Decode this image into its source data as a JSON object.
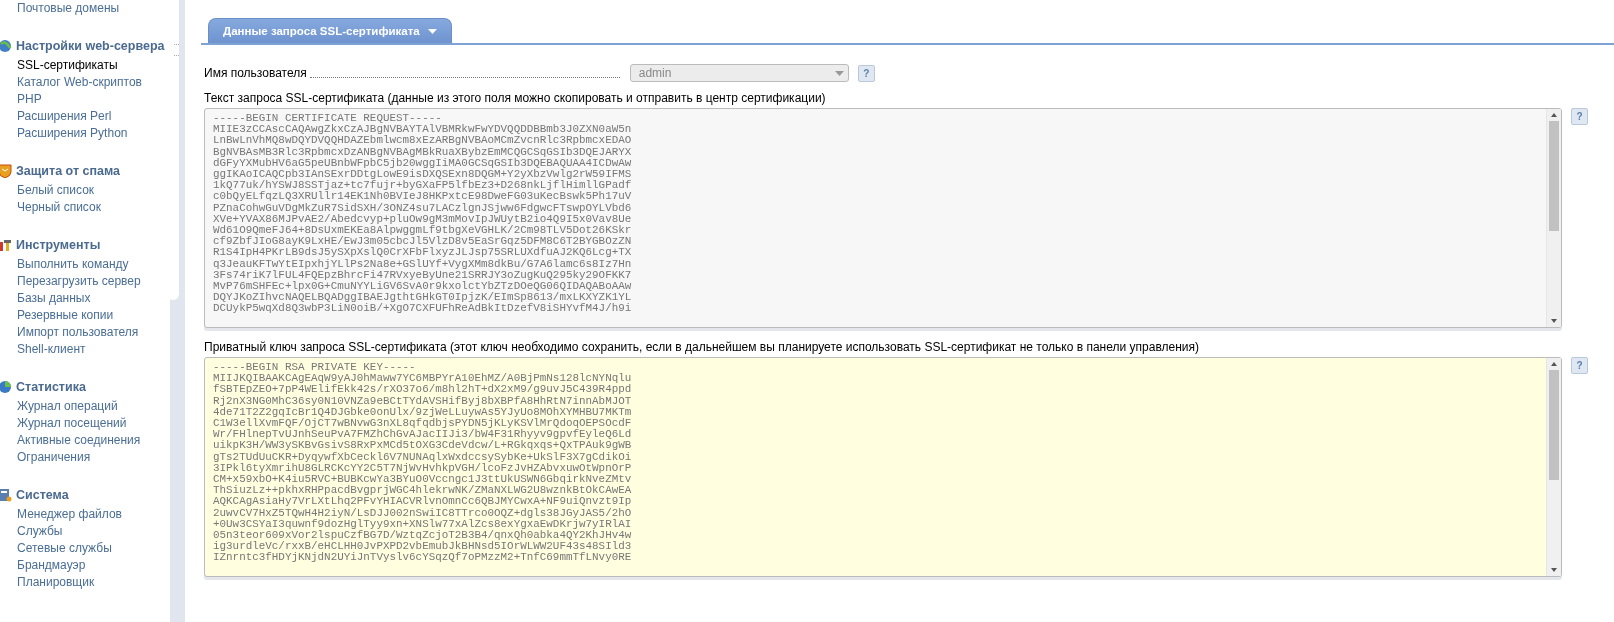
{
  "sidebar": {
    "groups": [
      {
        "items": [
          {
            "label": "Почтовые домены",
            "selected": false
          }
        ]
      },
      {
        "title": "Настройки web-сервера",
        "items": [
          {
            "label": "SSL-сертификаты",
            "selected": true
          },
          {
            "label": "Каталог Web-скриптов",
            "selected": false
          },
          {
            "label": "PHP",
            "selected": false
          },
          {
            "label": "Расширения Perl",
            "selected": false
          },
          {
            "label": "Расширения Python",
            "selected": false
          }
        ]
      },
      {
        "title": "Защита от спама",
        "items": [
          {
            "label": "Белый список",
            "selected": false
          },
          {
            "label": "Черный список",
            "selected": false
          }
        ]
      },
      {
        "title": "Инструменты",
        "items": [
          {
            "label": "Выполнить команду",
            "selected": false
          },
          {
            "label": "Перезагрузить сервер",
            "selected": false
          },
          {
            "label": "Базы данных",
            "selected": false
          },
          {
            "label": "Резервные копии",
            "selected": false
          },
          {
            "label": "Импорт пользователя",
            "selected": false
          },
          {
            "label": "Shell-клиент",
            "selected": false
          }
        ]
      },
      {
        "title": "Статистика",
        "items": [
          {
            "label": "Журнал операций",
            "selected": false
          },
          {
            "label": "Журнал посещений",
            "selected": false
          },
          {
            "label": "Активные соединения",
            "selected": false
          },
          {
            "label": "Ограничения",
            "selected": false
          }
        ]
      },
      {
        "title": "Система",
        "items": [
          {
            "label": "Менеджер файлов",
            "selected": false
          },
          {
            "label": "Службы",
            "selected": false
          },
          {
            "label": "Сетевые службы",
            "selected": false
          },
          {
            "label": "Брандмауэр",
            "selected": false
          },
          {
            "label": "Планировщик",
            "selected": false
          }
        ]
      }
    ]
  },
  "tab": {
    "label": "Данные запроса SSL-сертификата"
  },
  "fields": [
    {
      "kind": "select",
      "label": "Имя пользователя",
      "value": "admin",
      "disabled": true,
      "help": "?"
    },
    {
      "kind": "textarea",
      "label": "Текст запроса SSL-сертификата (данные из этого поля можно скопировать и отправить в центр сертификации)",
      "highlighted": false,
      "help": "?",
      "lines": [
        "-----BEGIN CERTIFICATE REQUEST-----",
        "MIIE3zCCAscCAQAwgZkxCzAJBgNVBAYTAlVBMRkwFwYDVQQDDBBmb3J0ZXN0aW5n",
        "LnBwLnVhMQ8wDQYDVQQHDAZEbmlwcm8xEzARBgNVBAoMCmZvcnRlc3RpbmcxEDAO",
        "BgNVBAsMB3Rlc3RpbmcxDzANBgNVBAgMBkRuaXBybzEmMCQGCSqGSIb3DQEJARYX",
        "dGFyYXMubHV6aG5peUBnbWFpbC5jb20wggIiMA0GCSqGSIb3DQEBAQUAA4ICDwAw",
        "ggIKAoICAQCpb3IAnSExrDDtgLowE9isDXQSExn8DQGM+Y2yXbzVwlg2rW59IFMS",
        "1kQ77uk/hYSWJ8SSTjaz+tc7fujr+byGXaFP5lfbEz3+D268nkLjflHimllGPadf",
        "c0bQyELfqzLQ3XRUllr14EK1Nh0BVIeJ8HKPxtcE98DweFG03uKecBswk5Ph17uV",
        "PZnaCohwGuVDgMkZuR7SidSXH/3ONZ4su7LACzlgnJSjww6FdgwcFTswpOYLVbd6",
        "XVe+YVAX86MJPvAE2/Abedcvyp+pluOw9gM3mMovIpJWUytB2io4Q9I5x0Vav8Ue",
        "Wd61O9QmeFJ64+8DsUxmEKEa8AlpwggmLf9tbgXeVGHLK/2Cm98TLV5Dot26KSkr",
        "cf9ZbfJIoG8ayK9LxHE/EwJ3m05cbcJl5VlzD8v5EaSrGqz5DFM8C6T2BYGBOzZN",
        "R1S4IpH4PKrLB9dsJ5ySXpXslQ0CrXFbFlxyzJLJsp75SRLUXdfuAJ2KQ6Lcg+TX",
        "q3JeauKFTwYtEIpxhjYLlPs2Na8e+GSlUYf+VygXMm8dkBu/G7A6lamc6s8Iz7Hn",
        "3Fs74riK7lFUL4FQEpzBhrcFi47RVxyeByUne21SRRJY3oZugKuQ295ky29OFKK7",
        "MvP76mSHFEc+lpx0G+CmuNYYLiGV6SvA0r9kxolctYbZTzDOeQG06QIDAQABoAAw",
        "DQYJKoZIhvcNAQELBQADggIBAEJgthtGHkGT0IpjzK/EImSp8613/mxLKXYZK1YL",
        "DCUykP5wqXd8Q3wbP3LiN0oiB/+XgO7CXFUFhReAdBkItDzefV8iSHYvfM4J/h9i"
      ]
    },
    {
      "kind": "textarea",
      "label": "Приватный ключ запроса SSL-сертификата (этот ключ необходимо сохранить, если в дальнейшем вы планируете использовать SSL-сертификат не только в панели управления)",
      "highlighted": true,
      "help": "?",
      "lines": [
        "-----BEGIN RSA PRIVATE KEY-----",
        "MIIJKQIBAAKCAgEAqW9yAJ0hMaww7YC6MBPYrA10EhMZ/A0BjPmNs128lcNYNqlu",
        "fSBTEpZEO+7pP4WElifEkk42s/rXO37o6/m8hl2hT+dX2xM9/g9uvJ5C439R4ppd",
        "Rj2nX3NG0MhC36sy0N10VNZa9eBCtTYdAVSHifByj8bXBPfA8HhRtN7innAbMJOT",
        "4de71T2Z2gqIcBr1Q4DJGbke0onUlx/9zjWeLLuywAs5YJyUo8MOhXYMHBU7MKTm",
        "C1W3ellXvmFQF/OjCT7wBNvwG3nXL8qfqdbjsPYDN5jKLyKSVlMrQdoqOEPSOcdF",
        "Wr/FHlnepTvUJnhSeuPvA7FMZhChGvAJacIIJi3/bW4F31Rhyyv9gpvfEyleQ6Ld",
        "uikpK3H/WW3ySKBvGsivS8RxPxMCd5tOXG3CdeVdcw/L+RGkqxqs+QxTPAuk9gWB",
        "gTs2TUdUuCKR+DyqywfXbCeckl6V7NUNAqlxWxdccsySybKe+UkSlF3X7gCdikOi",
        "3IPkl6tyXmrihU8GLRCKcYY2C5T7NjWvHvhkpVGH/lcoFzJvHZAbvxuwOtWpnOrP",
        "CM+x59xbO+K4iu5RVC+BUBKcwYa3BYuO0Vccngc1J3ttUkUSWN6GbqirkNveZMtv",
        "ThSiuzLz++pkhxRHPpacdBvgprjWGC4hlekrwNK/ZMaNXLWG2U8wznkBtOkCAwEA",
        "AQKCAgAsiaHy7VrLXtLhq2PFvYHIACVRlvnOmnCc6QBJMYCwxA+NF9uiQnvzt9Ip",
        "2uwvCV7HxZ5TQwH4H2iyN/LsDJJ002nSwiIC8TTrco0OQZ+dgls38JGyJAS5/2hO",
        "+0Uw3CSYaI3quwnf9dozHglTyy9xn+XNSlw77xAlZcs8exYgxaEwDKrjw7yIRlAI",
        "05n3teor609xVor2lspuCzfBG7D/WztqZcjoT2B3B4/qnxQh0abka4QY2KhJHv4w",
        "ig3urdleVc/rxxB/eHCLHH0JvPXPD2vbEmubJkBHNsd5IOrWLWW2UF43s48SIld3",
        "IZnrntc3fHDYjKNjdN2UYiJnTVyslv6cYSqzQf7oPMzzM2+TnfC69mmTfLNvy0RE"
      ]
    }
  ]
}
